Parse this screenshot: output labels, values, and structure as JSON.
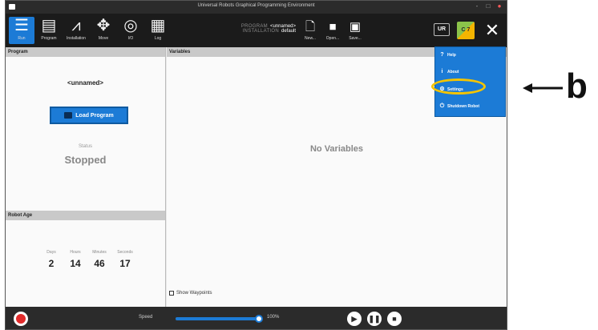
{
  "window": {
    "title": "Universal Robots Graphical Programming Environment",
    "controls": [
      "-",
      "□",
      "●"
    ]
  },
  "nav": {
    "tabs": [
      {
        "label": "Run",
        "icon": "ur-logo-icon"
      },
      {
        "label": "Program",
        "icon": "program-icon"
      },
      {
        "label": "Installation",
        "icon": "installation-icon"
      },
      {
        "label": "Move",
        "icon": "move-icon"
      },
      {
        "label": "I/O",
        "icon": "io-icon"
      },
      {
        "label": "Log",
        "icon": "log-icon"
      }
    ]
  },
  "program_info": {
    "program_key": "PROGRAM",
    "program_value": "<unnamed>",
    "installation_key": "INSTALLATION",
    "installation_value": "default"
  },
  "file_buttons": {
    "new_label": "New...",
    "open_label": "Open...",
    "save_label": "Save..."
  },
  "header_right": {
    "manual_badge": "UR",
    "cert_badge": "C 7"
  },
  "program_panel": {
    "header": "Program",
    "name": "<unnamed>",
    "load_button": "Load Program",
    "status_label": "Status",
    "status_value": "Stopped"
  },
  "robot_age": {
    "header": "Robot Age",
    "units": [
      {
        "label": "Days",
        "value": "2"
      },
      {
        "label": "Hours",
        "value": "14"
      },
      {
        "label": "Minutes",
        "value": "46"
      },
      {
        "label": "Seconds",
        "value": "17"
      }
    ]
  },
  "variables_panel": {
    "header": "Variables",
    "empty_text": "No Variables",
    "show_waypoints": "Show Waypoints"
  },
  "footer": {
    "speed_label": "Speed",
    "speed_value": "100%",
    "speed_fraction": 1.0
  },
  "dropdown_menu": {
    "items": [
      {
        "label": "Help",
        "icon": "help-icon"
      },
      {
        "label": "About",
        "icon": "info-icon"
      },
      {
        "label": "Settings",
        "icon": "settings-icon"
      },
      {
        "label": "Shutdown Robot",
        "icon": "power-icon"
      }
    ],
    "highlighted_item": "Settings"
  },
  "annotation": {
    "letter": "b"
  },
  "colors": {
    "accent": "#1c7bd6",
    "header_bg": "#1b1b1b",
    "highlight_ring": "#f4c400",
    "stop_red": "#e12b2b"
  }
}
